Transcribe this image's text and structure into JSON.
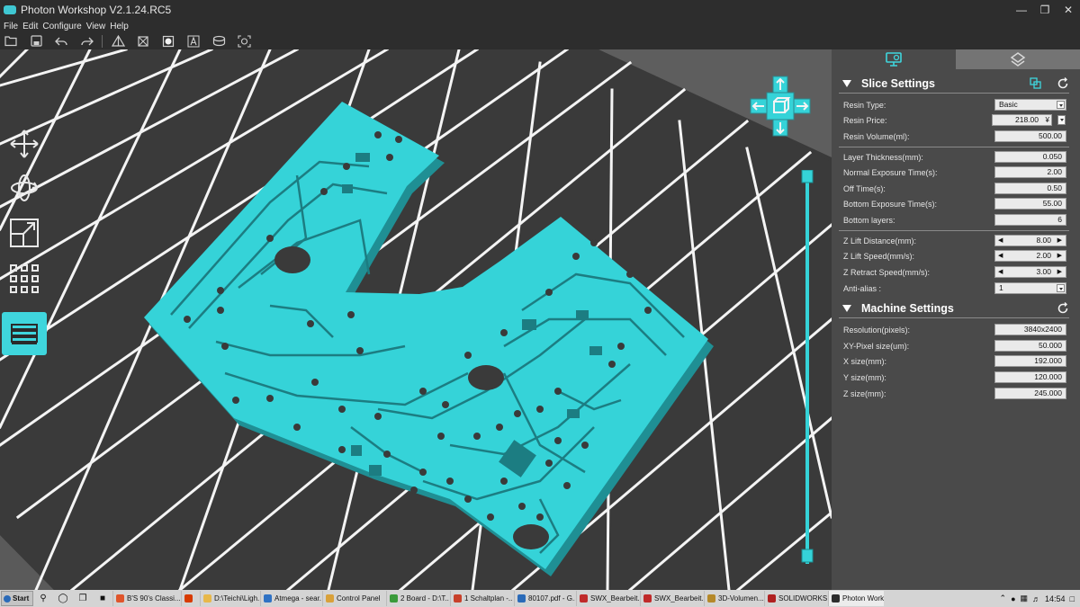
{
  "window": {
    "title": "Photon Workshop V2.1.24.RC5",
    "controls": [
      "minimize-icon",
      "restore-icon",
      "close-icon"
    ]
  },
  "menu": [
    "File",
    "Edit",
    "Configure",
    "View",
    "Help"
  ],
  "toolbar": {
    "icons": [
      "open-icon",
      "save-icon",
      "undo-icon",
      "redo-icon",
      "slice-view-icon",
      "wireframe-icon",
      "solid-view-icon",
      "text-tool-icon",
      "hollow-icon",
      "support-icon"
    ]
  },
  "left_tools": [
    "move-icon",
    "rotate-icon",
    "scale-icon",
    "arrange-icon",
    "layers-icon"
  ],
  "panel": {
    "tabs": [
      "printer-settings-icon",
      "support-settings-icon"
    ],
    "slice_settings": {
      "title": "Slice Settings",
      "resin_type": {
        "label": "Resin Type:",
        "value": "Basic"
      },
      "resin_price": {
        "label": "Resin Price:",
        "value": "218.00",
        "currency": "¥"
      },
      "resin_volume": {
        "label": "Resin Volume(ml):",
        "value": "500.00"
      },
      "layer_thickness": {
        "label": "Layer Thickness(mm):",
        "value": "0.050"
      },
      "normal_exposure": {
        "label": "Normal Exposure Time(s):",
        "value": "2.00"
      },
      "off_time": {
        "label": "Off Time(s):",
        "value": "0.50"
      },
      "bottom_exposure": {
        "label": "Bottom Exposure Time(s):",
        "value": "55.00"
      },
      "bottom_layers": {
        "label": "Bottom layers:",
        "value": "6"
      },
      "z_lift_distance": {
        "label": "Z Lift Distance(mm):",
        "value": "8.00"
      },
      "z_lift_speed": {
        "label": "Z Lift Speed(mm/s):",
        "value": "2.00"
      },
      "z_retract_speed": {
        "label": "Z Retract Speed(mm/s):",
        "value": "3.00"
      },
      "anti_alias": {
        "label": "Anti-alias :",
        "value": "1"
      }
    },
    "machine_settings": {
      "title": "Machine Settings",
      "resolution": {
        "label": "Resolution(pixels):",
        "value": "3840x2400"
      },
      "xy_pixel_size": {
        "label": "XY-Pixel size(um):",
        "value": "50.000"
      },
      "x_size": {
        "label": "X size(mm):",
        "value": "192.000"
      },
      "y_size": {
        "label": "Y size(mm):",
        "value": "120.000"
      },
      "z_size": {
        "label": "Z size(mm):",
        "value": "245.000"
      }
    }
  },
  "colors": {
    "accent": "#3fd6dd",
    "model": "#35d3d8",
    "viewport_bg": "#3a3a3a",
    "panel_bg": "#4a4a4a"
  },
  "taskbar": {
    "start": "Start",
    "tasks": [
      {
        "label": "B'S 90's Classi...",
        "color": "#e0552b"
      },
      {
        "label": "",
        "color": "#d83b01"
      },
      {
        "label": "D:\\Teichi\\Ligh...",
        "color": "#e8b84a"
      },
      {
        "label": "Atmega - sear...",
        "color": "#2f72c4"
      },
      {
        "label": "Control Panel",
        "color": "#d9a13a"
      },
      {
        "label": "2 Board - D:\\T...",
        "color": "#3a9a3a"
      },
      {
        "label": "1 Schaltplan -...",
        "color": "#c8402a"
      },
      {
        "label": "80107.pdf - G...",
        "color": "#2a6ab8"
      },
      {
        "label": "SWX_Bearbeit...",
        "color": "#c02a2a"
      },
      {
        "label": "SWX_Bearbeit...",
        "color": "#c02a2a"
      },
      {
        "label": "3D-Volumen...",
        "color": "#b5892a"
      },
      {
        "label": "SOLIDWORKS...",
        "color": "#b02020"
      },
      {
        "label": "Photon Work...",
        "color": "#2d2d2d"
      }
    ],
    "clock": "14:54"
  }
}
